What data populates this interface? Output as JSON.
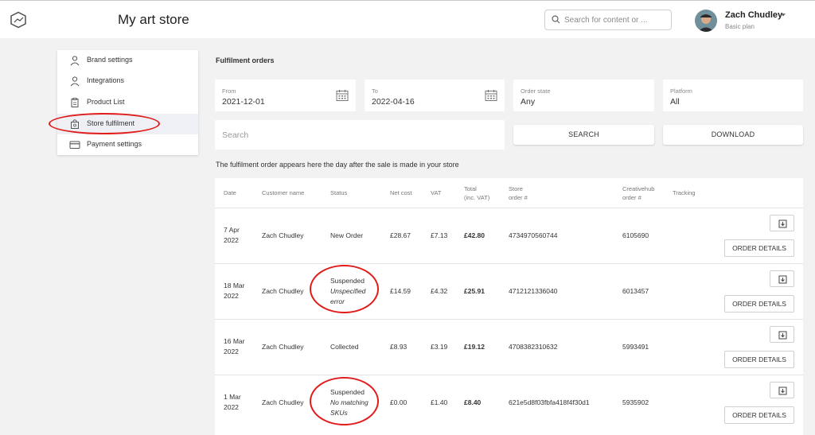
{
  "header": {
    "store_title": "My art store",
    "search_placeholder": "Search for content or ...",
    "user_name": "Zach Chudley",
    "user_plan": "Basic plan"
  },
  "sidebar": {
    "items": [
      {
        "label": "Brand settings",
        "icon": "person-icon"
      },
      {
        "label": "Integrations",
        "icon": "person-icon"
      },
      {
        "label": "Product List",
        "icon": "clipboard-icon"
      },
      {
        "label": "Store fulfilment",
        "icon": "shopping-bag-icon",
        "active": true
      },
      {
        "label": "Payment settings",
        "icon": "credit-card-icon"
      }
    ]
  },
  "main": {
    "section_title": "Fulfilment orders",
    "filters": {
      "from_label": "From",
      "from_value": "2021-12-01",
      "to_label": "To",
      "to_value": "2022-04-16",
      "order_state_label": "Order state",
      "order_state_value": "Any",
      "platform_label": "Platform",
      "platform_value": "All"
    },
    "search_placeholder": "Search",
    "search_button": "SEARCH",
    "download_button": "DOWNLOAD",
    "info_text": "The fulfilment order appears here the day after the sale is made in your store"
  },
  "table": {
    "headers": {
      "date": "Date",
      "customer": "Customer name",
      "status": "Status",
      "net_cost": "Net cost",
      "vat": "VAT",
      "total_1": "Total",
      "total_2": "(inc. VAT)",
      "store_order_1": "Store",
      "store_order_2": "order #",
      "ch_order_1": "Creativehub",
      "ch_order_2": "order #",
      "tracking": "Tracking"
    },
    "order_details_label": "ORDER DETAILS",
    "rows": [
      {
        "date_1": "7 Apr",
        "date_2": "2022",
        "customer": "Zach Chudley",
        "status": "New Order",
        "status_detail_1": "",
        "status_detail_2": "",
        "net_cost": "£28.67",
        "vat": "£7.13",
        "total": "£42.80",
        "store_order": "4734970560744",
        "ch_order": "6105690"
      },
      {
        "date_1": "18 Mar",
        "date_2": "2022",
        "customer": "Zach Chudley",
        "status": "Suspended",
        "status_detail_1": "Unspecified",
        "status_detail_2": "error",
        "net_cost": "£14.59",
        "vat": "£4.32",
        "total": "£25.91",
        "store_order": "4712121336040",
        "ch_order": "6013457"
      },
      {
        "date_1": "16 Mar",
        "date_2": "2022",
        "customer": "Zach Chudley",
        "status": "Collected",
        "status_detail_1": "",
        "status_detail_2": "",
        "net_cost": "£8.93",
        "vat": "£3.19",
        "total": "£19.12",
        "store_order": "4708382310632",
        "ch_order": "5993491"
      },
      {
        "date_1": "1 Mar",
        "date_2": "2022",
        "customer": "Zach Chudley",
        "status": "Suspended",
        "status_detail_1": "No matching",
        "status_detail_2": "SKUs",
        "net_cost": "£0.00",
        "vat": "£1.40",
        "total": "£8.40",
        "store_order": "621e5d8f03fbfa418f4f30d1",
        "ch_order": "5935902"
      }
    ]
  },
  "colors": {
    "annotation": "#e21b1b",
    "active_bg": "#eef0f5",
    "page_bg": "#f2f2f2"
  }
}
